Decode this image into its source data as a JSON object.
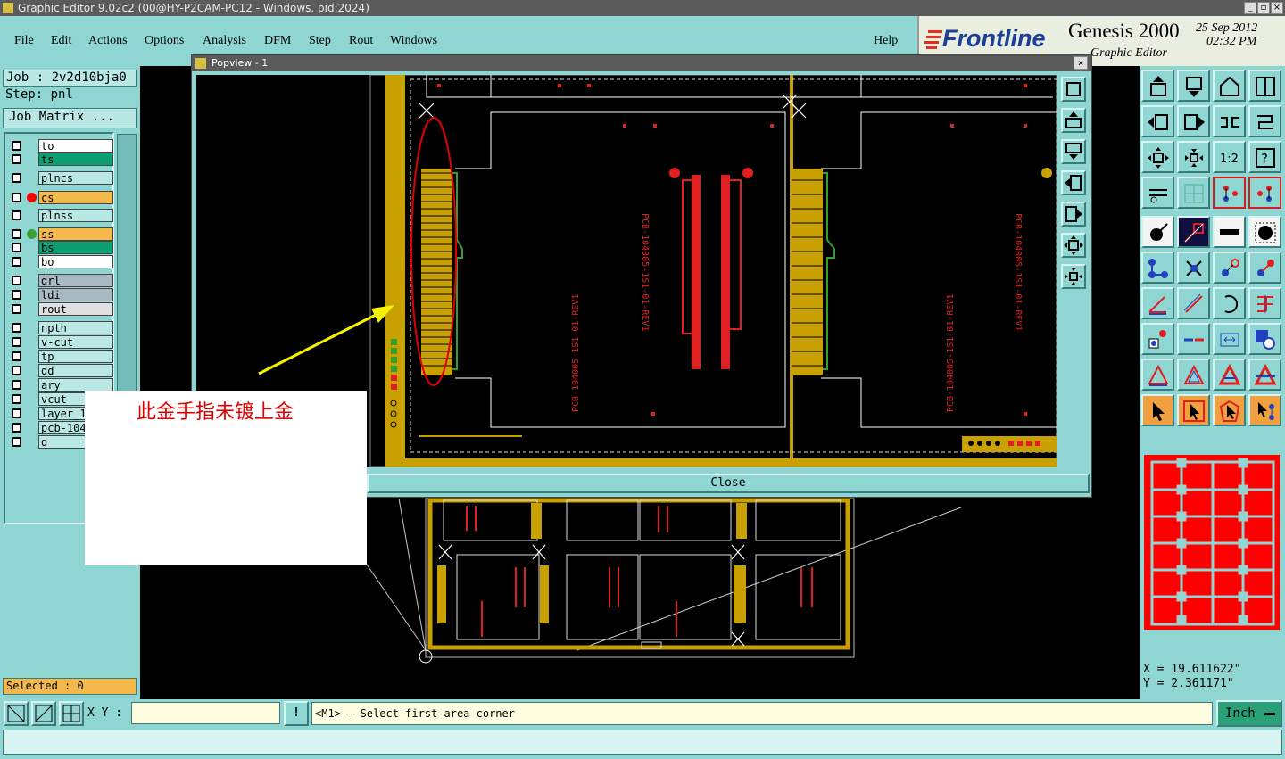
{
  "titlebar": {
    "title": "Graphic Editor 9.02c2 (00@HY-P2CAM-PC12 - Windows, pid:2024)",
    "controls": [
      "_",
      "▫",
      "×"
    ]
  },
  "menu": {
    "items": [
      "File",
      "Edit",
      "Actions",
      "Options",
      "Analysis",
      "DFM",
      "Step",
      "Rout",
      "Windows"
    ],
    "help": "Help"
  },
  "logo": {
    "brand": "Frontline",
    "product": "Genesis 2000",
    "subtitle": "Graphic Editor",
    "date": "25 Sep 2012",
    "time": "02:32 PM"
  },
  "left": {
    "job": "Job : 2v2d10bja0",
    "step": "Step: pnl",
    "matrix_btn": "Job Matrix ...",
    "layers": [
      {
        "name": "to",
        "color": "#ffffff",
        "dot": ""
      },
      {
        "name": "ts",
        "color": "#0d9f74",
        "dot": ""
      },
      {
        "name": "plncs",
        "color": "#b9e8e5",
        "dot": ""
      },
      {
        "name": "cs",
        "color": "#f5b84a",
        "dot": "#ff0000"
      },
      {
        "name": "plnss",
        "color": "#b9e8e5",
        "dot": ""
      },
      {
        "name": "ss",
        "color": "#f5b84a",
        "dot": "#3aa030"
      },
      {
        "name": "bs",
        "color": "#0d9f74",
        "dot": ""
      },
      {
        "name": "bo",
        "color": "#ffffff",
        "dot": ""
      },
      {
        "name": "drl",
        "color": "#a9b9c4",
        "dot": ""
      },
      {
        "name": "ldi",
        "color": "#a9b9c4",
        "dot": ""
      },
      {
        "name": "rout",
        "color": "#e0e0e0",
        "dot": ""
      },
      {
        "name": "npth",
        "color": "#b9e8e5",
        "dot": ""
      },
      {
        "name": "v-cut",
        "color": "#b9e8e5",
        "dot": ""
      },
      {
        "name": "tp",
        "color": "#b9e8e5",
        "dot": ""
      },
      {
        "name": "dd",
        "color": "#b9e8e5",
        "dot": ""
      },
      {
        "name": "ary",
        "color": "#b9e8e5",
        "dot": ""
      },
      {
        "name": "vcut",
        "color": "#b9e8e5",
        "dot": ""
      },
      {
        "name": "layer_1...",
        "color": "#b9e8e5",
        "dot": ""
      },
      {
        "name": "pcb-1040...",
        "color": "#b9e8e5",
        "dot": ""
      },
      {
        "name": "d",
        "color": "#b9e8e5",
        "dot": ""
      }
    ],
    "selected": "Selected : 0"
  },
  "popview": {
    "title": "Popview - 1",
    "close_label": "Close",
    "pcb_label": "PCB-104005-1S1-01-REV1"
  },
  "annotation": {
    "text": "此金手指未镀上金"
  },
  "coords": {
    "x": "X = 19.611622\"",
    "y": "Y = 2.361171\""
  },
  "status": {
    "xy_label": "X Y :",
    "xy_value": "",
    "prompt": "<M1> - Select first area corner",
    "units": "Inch"
  }
}
